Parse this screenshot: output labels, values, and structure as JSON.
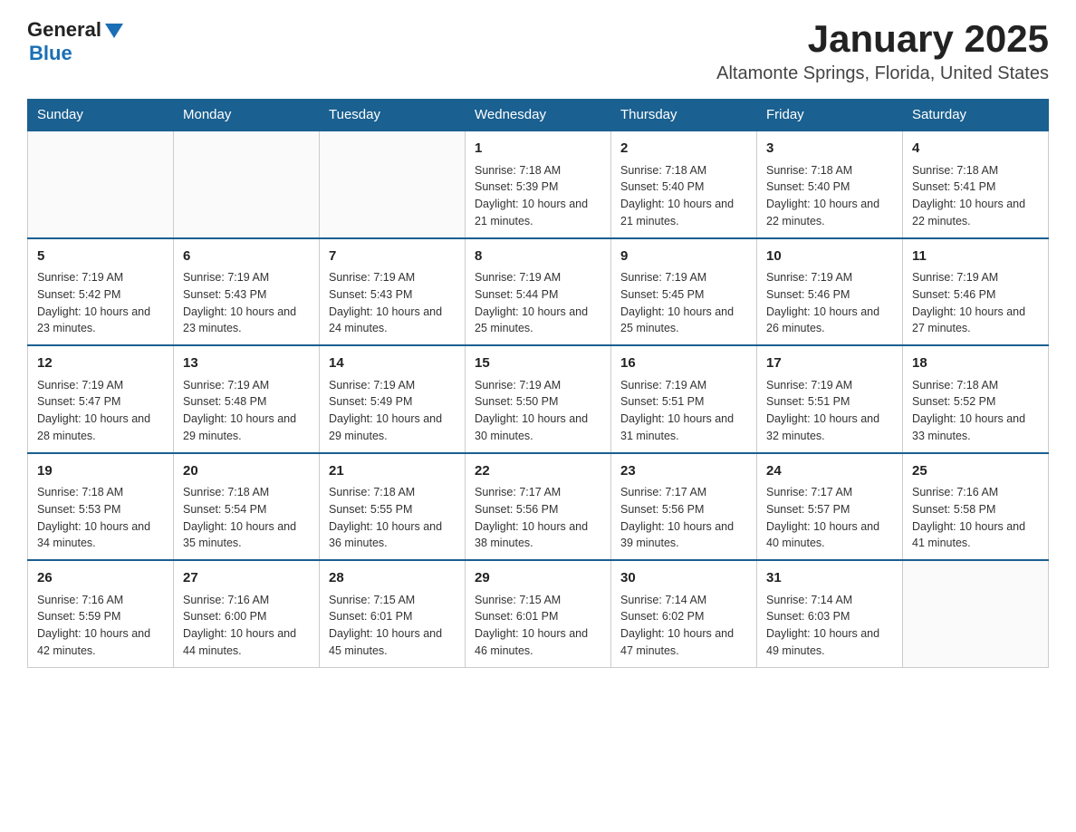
{
  "header": {
    "logo_general": "General",
    "logo_blue": "Blue",
    "month_title": "January 2025",
    "location": "Altamonte Springs, Florida, United States"
  },
  "weekdays": [
    "Sunday",
    "Monday",
    "Tuesday",
    "Wednesday",
    "Thursday",
    "Friday",
    "Saturday"
  ],
  "weeks": [
    [
      {
        "day": "",
        "info": ""
      },
      {
        "day": "",
        "info": ""
      },
      {
        "day": "",
        "info": ""
      },
      {
        "day": "1",
        "info": "Sunrise: 7:18 AM\nSunset: 5:39 PM\nDaylight: 10 hours and 21 minutes."
      },
      {
        "day": "2",
        "info": "Sunrise: 7:18 AM\nSunset: 5:40 PM\nDaylight: 10 hours and 21 minutes."
      },
      {
        "day": "3",
        "info": "Sunrise: 7:18 AM\nSunset: 5:40 PM\nDaylight: 10 hours and 22 minutes."
      },
      {
        "day": "4",
        "info": "Sunrise: 7:18 AM\nSunset: 5:41 PM\nDaylight: 10 hours and 22 minutes."
      }
    ],
    [
      {
        "day": "5",
        "info": "Sunrise: 7:19 AM\nSunset: 5:42 PM\nDaylight: 10 hours and 23 minutes."
      },
      {
        "day": "6",
        "info": "Sunrise: 7:19 AM\nSunset: 5:43 PM\nDaylight: 10 hours and 23 minutes."
      },
      {
        "day": "7",
        "info": "Sunrise: 7:19 AM\nSunset: 5:43 PM\nDaylight: 10 hours and 24 minutes."
      },
      {
        "day": "8",
        "info": "Sunrise: 7:19 AM\nSunset: 5:44 PM\nDaylight: 10 hours and 25 minutes."
      },
      {
        "day": "9",
        "info": "Sunrise: 7:19 AM\nSunset: 5:45 PM\nDaylight: 10 hours and 25 minutes."
      },
      {
        "day": "10",
        "info": "Sunrise: 7:19 AM\nSunset: 5:46 PM\nDaylight: 10 hours and 26 minutes."
      },
      {
        "day": "11",
        "info": "Sunrise: 7:19 AM\nSunset: 5:46 PM\nDaylight: 10 hours and 27 minutes."
      }
    ],
    [
      {
        "day": "12",
        "info": "Sunrise: 7:19 AM\nSunset: 5:47 PM\nDaylight: 10 hours and 28 minutes."
      },
      {
        "day": "13",
        "info": "Sunrise: 7:19 AM\nSunset: 5:48 PM\nDaylight: 10 hours and 29 minutes."
      },
      {
        "day": "14",
        "info": "Sunrise: 7:19 AM\nSunset: 5:49 PM\nDaylight: 10 hours and 29 minutes."
      },
      {
        "day": "15",
        "info": "Sunrise: 7:19 AM\nSunset: 5:50 PM\nDaylight: 10 hours and 30 minutes."
      },
      {
        "day": "16",
        "info": "Sunrise: 7:19 AM\nSunset: 5:51 PM\nDaylight: 10 hours and 31 minutes."
      },
      {
        "day": "17",
        "info": "Sunrise: 7:19 AM\nSunset: 5:51 PM\nDaylight: 10 hours and 32 minutes."
      },
      {
        "day": "18",
        "info": "Sunrise: 7:18 AM\nSunset: 5:52 PM\nDaylight: 10 hours and 33 minutes."
      }
    ],
    [
      {
        "day": "19",
        "info": "Sunrise: 7:18 AM\nSunset: 5:53 PM\nDaylight: 10 hours and 34 minutes."
      },
      {
        "day": "20",
        "info": "Sunrise: 7:18 AM\nSunset: 5:54 PM\nDaylight: 10 hours and 35 minutes."
      },
      {
        "day": "21",
        "info": "Sunrise: 7:18 AM\nSunset: 5:55 PM\nDaylight: 10 hours and 36 minutes."
      },
      {
        "day": "22",
        "info": "Sunrise: 7:17 AM\nSunset: 5:56 PM\nDaylight: 10 hours and 38 minutes."
      },
      {
        "day": "23",
        "info": "Sunrise: 7:17 AM\nSunset: 5:56 PM\nDaylight: 10 hours and 39 minutes."
      },
      {
        "day": "24",
        "info": "Sunrise: 7:17 AM\nSunset: 5:57 PM\nDaylight: 10 hours and 40 minutes."
      },
      {
        "day": "25",
        "info": "Sunrise: 7:16 AM\nSunset: 5:58 PM\nDaylight: 10 hours and 41 minutes."
      }
    ],
    [
      {
        "day": "26",
        "info": "Sunrise: 7:16 AM\nSunset: 5:59 PM\nDaylight: 10 hours and 42 minutes."
      },
      {
        "day": "27",
        "info": "Sunrise: 7:16 AM\nSunset: 6:00 PM\nDaylight: 10 hours and 44 minutes."
      },
      {
        "day": "28",
        "info": "Sunrise: 7:15 AM\nSunset: 6:01 PM\nDaylight: 10 hours and 45 minutes."
      },
      {
        "day": "29",
        "info": "Sunrise: 7:15 AM\nSunset: 6:01 PM\nDaylight: 10 hours and 46 minutes."
      },
      {
        "day": "30",
        "info": "Sunrise: 7:14 AM\nSunset: 6:02 PM\nDaylight: 10 hours and 47 minutes."
      },
      {
        "day": "31",
        "info": "Sunrise: 7:14 AM\nSunset: 6:03 PM\nDaylight: 10 hours and 49 minutes."
      },
      {
        "day": "",
        "info": ""
      }
    ]
  ]
}
